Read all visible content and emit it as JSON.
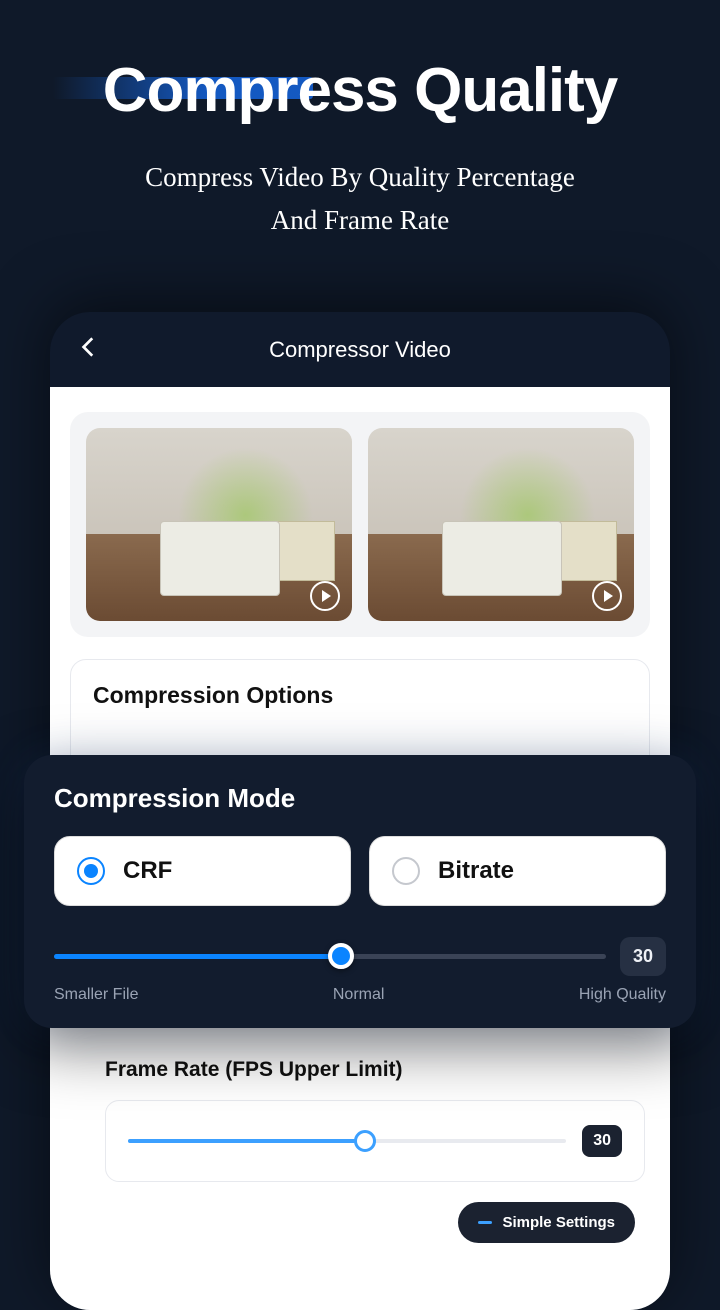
{
  "hero": {
    "title": "Compress Quality",
    "subtitle_line1": "Compress Video By Quality Percentage",
    "subtitle_line2": "And Frame Rate"
  },
  "app": {
    "header_title": "Compressor Video"
  },
  "options": {
    "title": "Compression Options"
  },
  "mode": {
    "title": "Compression Mode",
    "opt1": "CRF",
    "opt2": "Bitrate",
    "slider_value": "30",
    "label_low": "Smaller File",
    "label_mid": "Normal",
    "label_high": "High Quality"
  },
  "frame_rate": {
    "title": "Frame Rate (FPS Upper Limit)",
    "value": "30"
  },
  "toggle": {
    "label": "Simple Settings"
  }
}
